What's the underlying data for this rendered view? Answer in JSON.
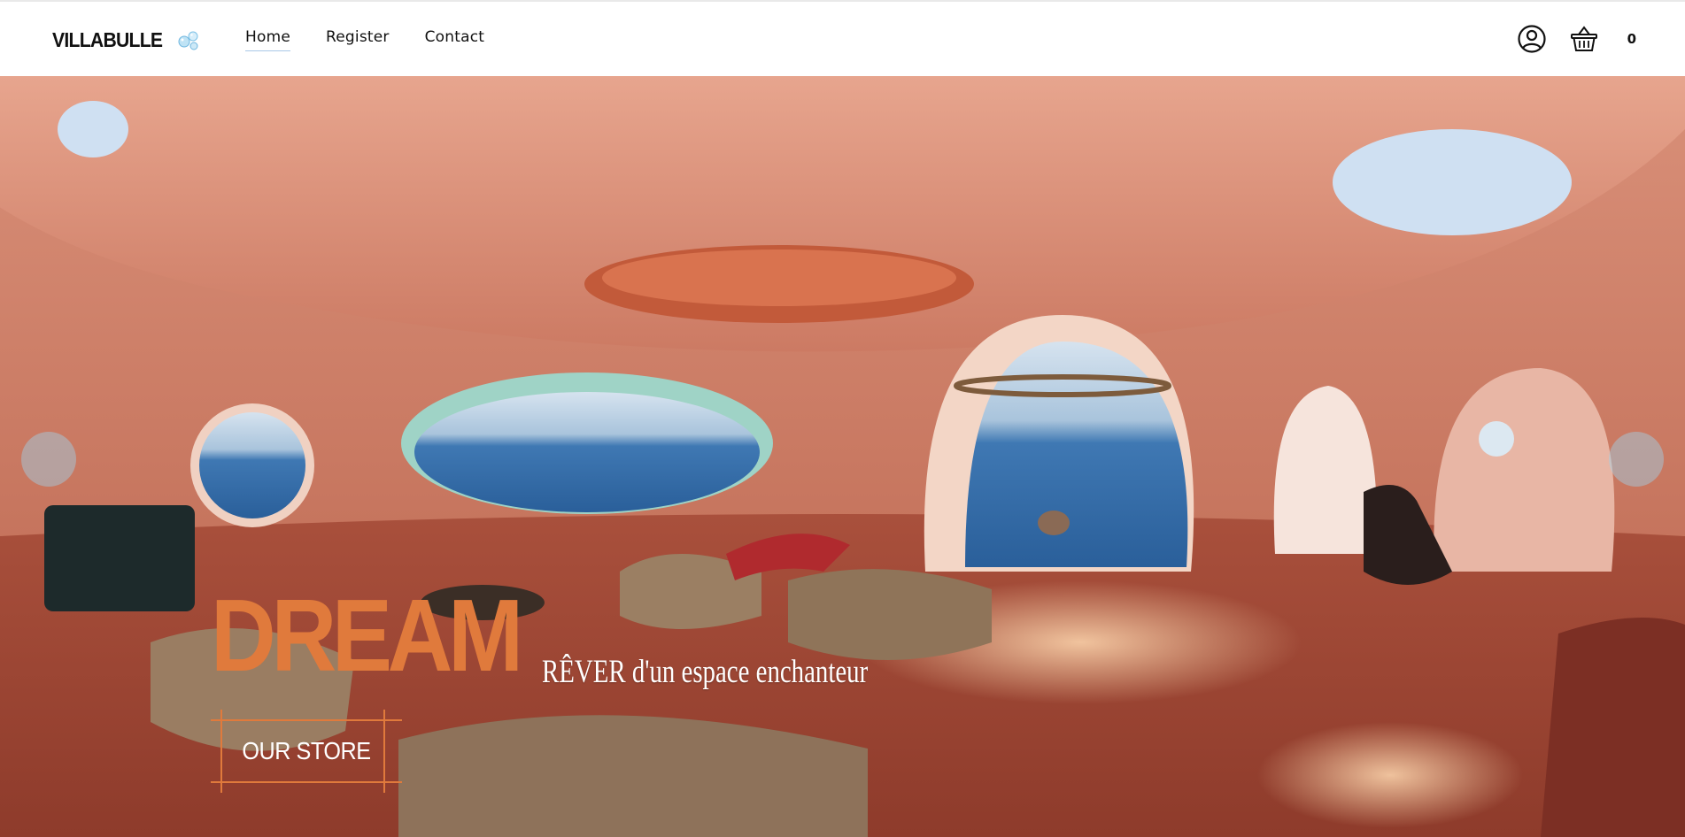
{
  "brand": {
    "name": "VILLABULLE",
    "logo_icon": "bubbles-icon"
  },
  "nav": {
    "items": [
      {
        "label": "Home",
        "active": true
      },
      {
        "label": "Register",
        "active": false
      },
      {
        "label": "Contact",
        "active": false
      }
    ]
  },
  "header_actions": {
    "account_icon": "user-circle-icon",
    "cart_icon": "basket-icon",
    "cart_count": "0"
  },
  "hero": {
    "title": "DREAM",
    "subtitle": "RÊVER d'un espace enchanteur",
    "cta_label": "OUR STORE",
    "prev_icon": "carousel-prev-icon",
    "next_icon": "carousel-next-icon"
  },
  "colors": {
    "accent_orange": "#e07a3c",
    "nav_underline": "#a9c7e6",
    "arrow_bubble": "#a0d2eb"
  }
}
